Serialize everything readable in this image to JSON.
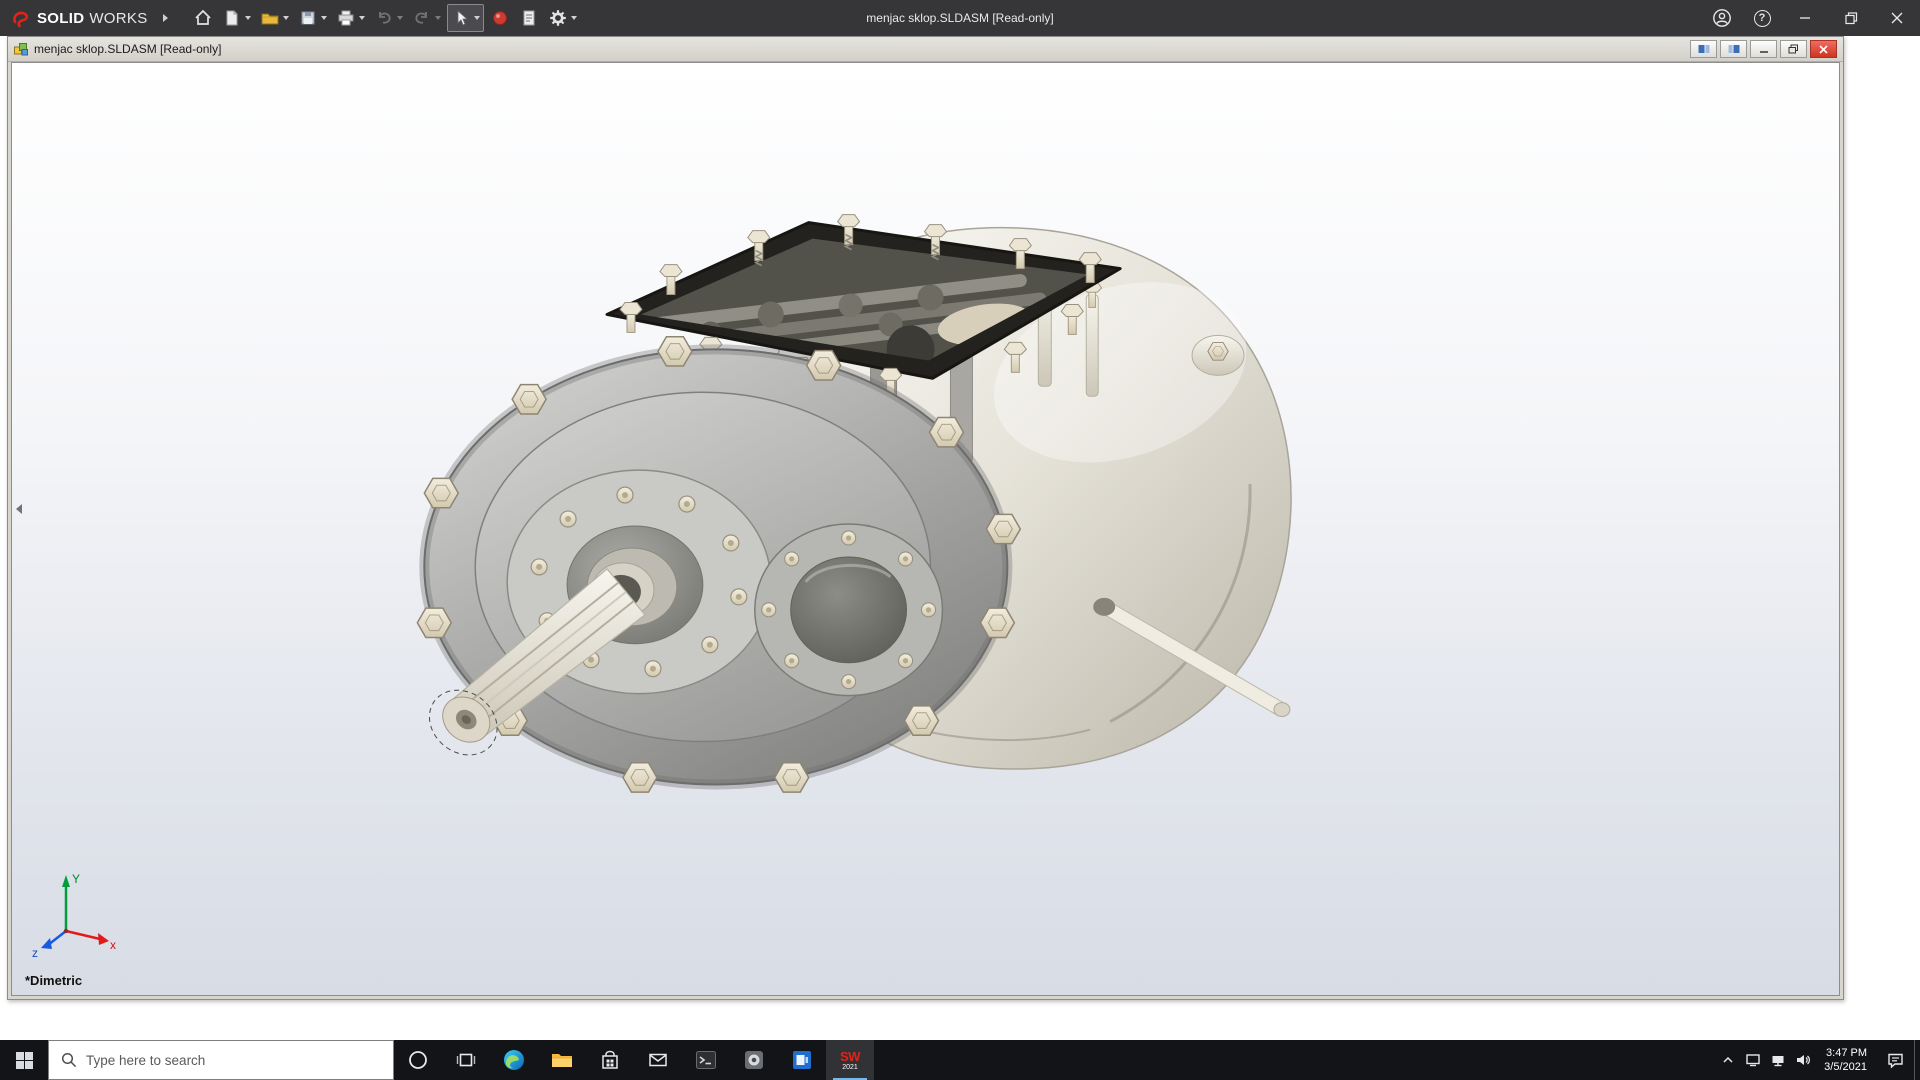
{
  "app": {
    "brand": {
      "solid": "SOLID",
      "works": "WORKS"
    },
    "window_title": "menjac sklop.SLDASM [Read-only]",
    "toolbar_icons": [
      "home",
      "new-document",
      "open",
      "save",
      "print",
      "undo",
      "redo",
      "select",
      "rebuild",
      "file-properties",
      "options"
    ],
    "help_glyph": "?"
  },
  "document": {
    "title": "menjac sklop.SLDASM [Read-only]",
    "view_orientation_label": "*Dimetric",
    "triad": {
      "x": "x",
      "y": "Y",
      "z": "z"
    }
  },
  "taskbar": {
    "search_placeholder": "Type here to search",
    "solidworks_badge": {
      "letters": "SW",
      "year": "2021"
    },
    "clock": {
      "time": "3:47 PM",
      "date": "3/5/2021"
    }
  },
  "colors": {
    "titlebar_bg": "#363639",
    "accent_red": "#e2231a",
    "taskbar_bg": "#121418",
    "close_red": "#cf3423"
  }
}
